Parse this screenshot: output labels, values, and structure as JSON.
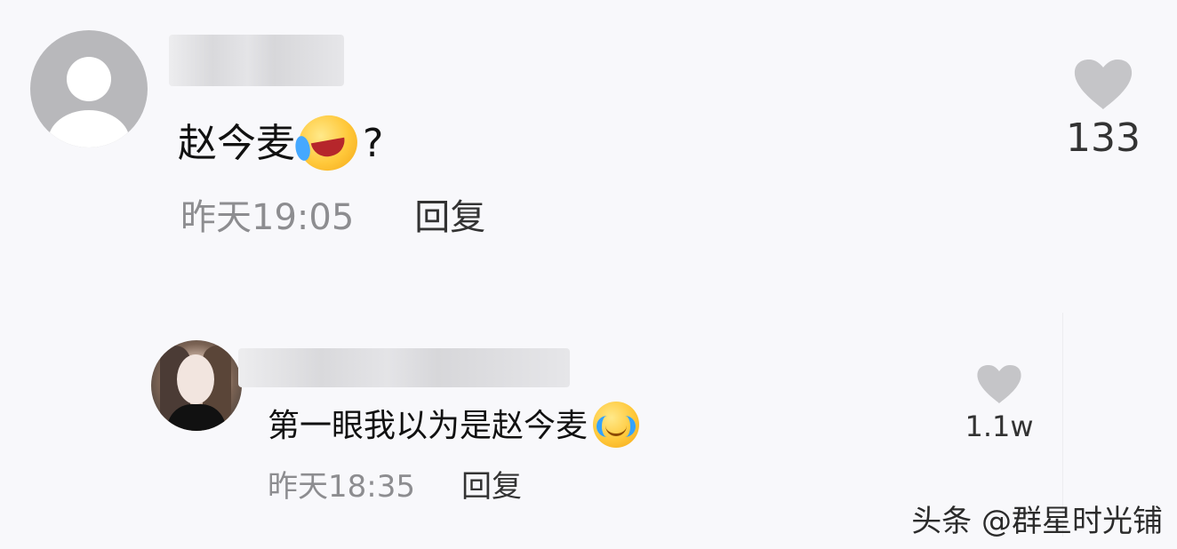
{
  "comment": {
    "text": "赵今麦",
    "question_mark": "?",
    "timestamp": "昨天19:05",
    "reply_label": "回复",
    "likes": "133",
    "emoji": "rolling-laughing-emoji"
  },
  "reply": {
    "text": "第一眼我以为是赵今麦",
    "timestamp": "昨天18:35",
    "reply_label": "回复",
    "likes": "1.1w",
    "emoji": "tears-of-joy-emoji"
  },
  "watermark": {
    "text": "头条 @群星时光铺"
  },
  "colors": {
    "background": "#f8f8fb",
    "text": "#111111",
    "muted_text": "#8d8d90",
    "heart": "#c5c5c8"
  },
  "icons": {
    "heart": "heart-icon",
    "default_avatar": "default-avatar-icon",
    "profile_avatar": "profile-avatar"
  }
}
